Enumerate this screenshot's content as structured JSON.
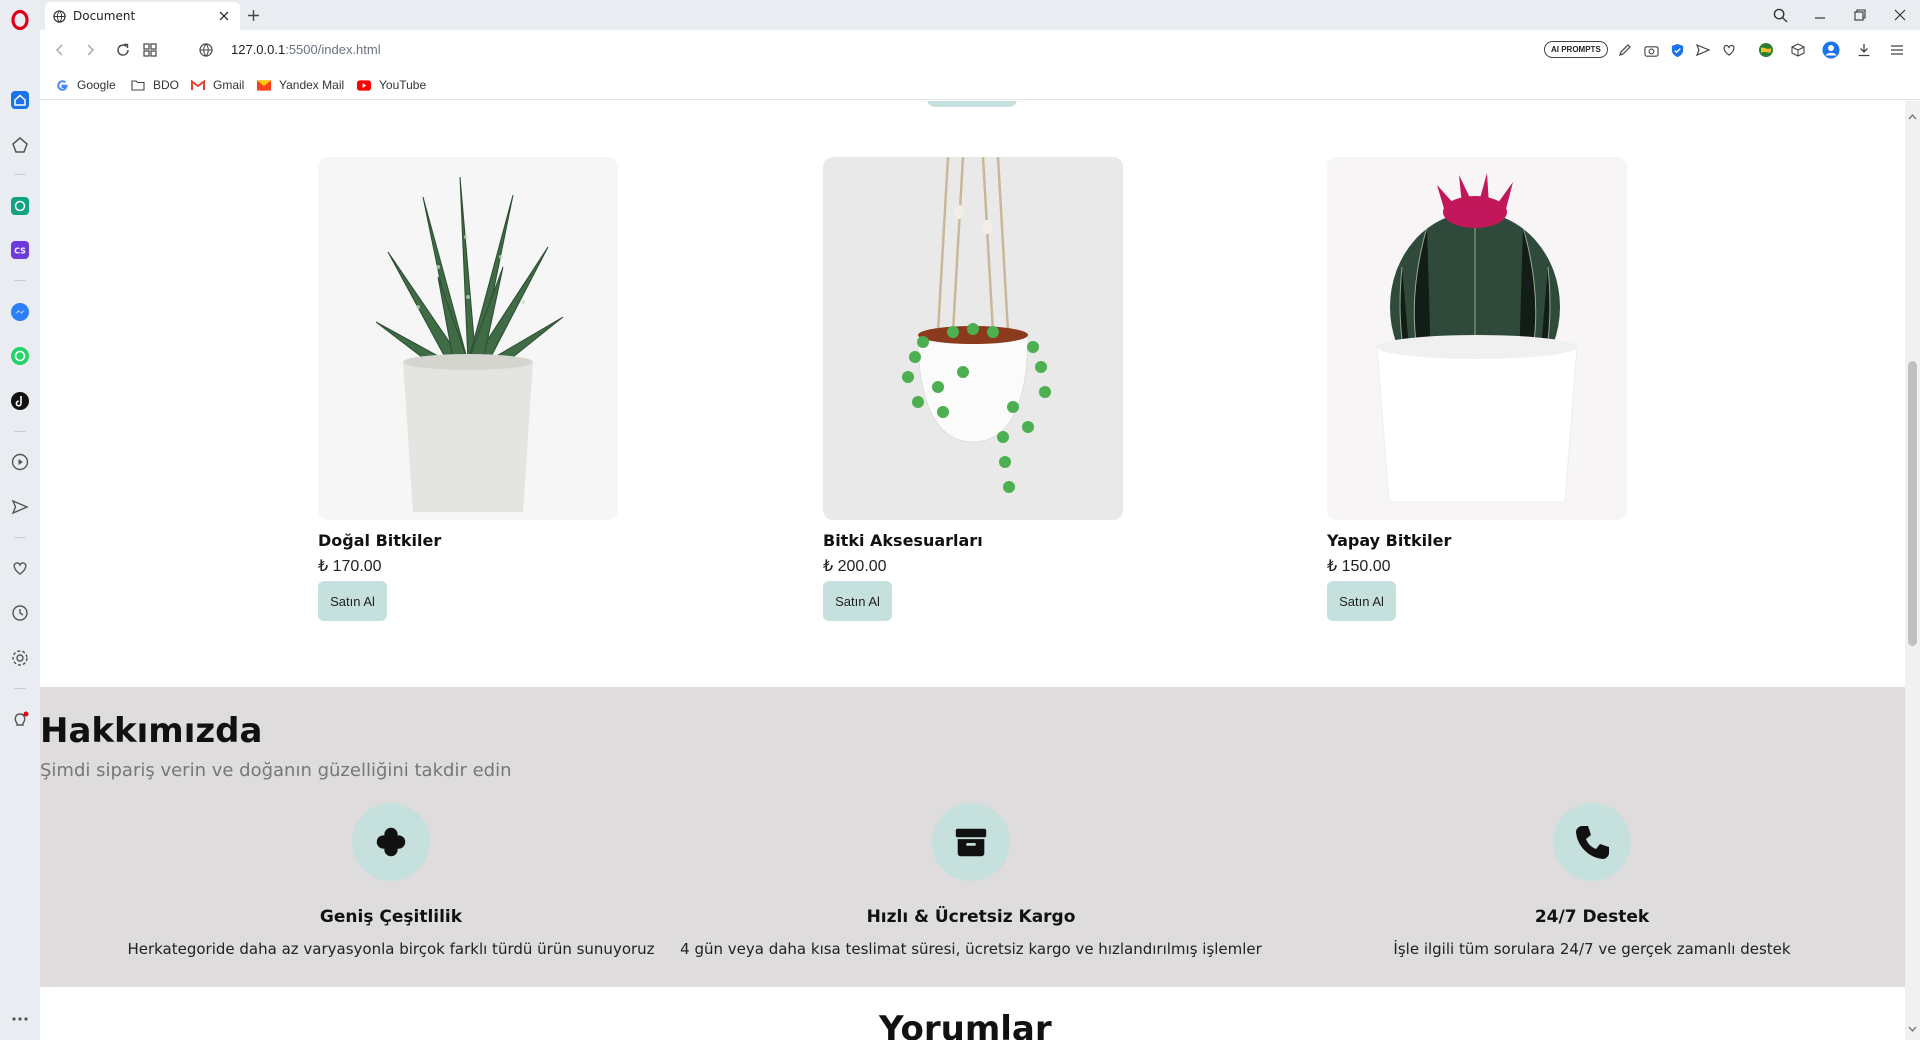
{
  "browser": {
    "tab_title": "Document",
    "url_host": "127.0.0.1",
    "url_rest": ":5500/index.html",
    "ai_prompts_label": "AI PROMPTS",
    "bookmarks": [
      {
        "label": "Google",
        "icon": "google-icon"
      },
      {
        "label": "BDO",
        "icon": "folder-icon"
      },
      {
        "label": "Gmail",
        "icon": "gmail-icon"
      },
      {
        "label": "Yandex Mail",
        "icon": "yandex-mail-icon"
      },
      {
        "label": "YouTube",
        "icon": "youtube-icon"
      }
    ]
  },
  "products": [
    {
      "name": "Doğal Bitkiler",
      "price": "₺ 170.00",
      "button": "Satın Al"
    },
    {
      "name": "Bitki Aksesuarları",
      "price": "₺ 200.00",
      "button": "Satın Al"
    },
    {
      "name": "Yapay Bitkiler",
      "price": "₺ 150.00",
      "button": "Satın Al"
    }
  ],
  "about": {
    "title": "Hakkımızda",
    "subtitle": "Şimdi sipariş verin ve doğanın güzelliğini takdir edin",
    "features": [
      {
        "icon": "clover-icon",
        "title": "Geniş Çeşitlilik",
        "desc": "Herkategoride daha az varyasyonla birçok farklı türdü ürün sunuyoruz"
      },
      {
        "icon": "box-icon",
        "title": "Hızlı & Ücretsiz Kargo",
        "desc": "4 gün veya daha kısa teslimat süresi, ücretsiz kargo ve hızlandırılmış işlemler"
      },
      {
        "icon": "phone-icon",
        "title": "24/7 Destek",
        "desc": "İşle ilgili tüm sorulara 24/7 ve gerçek zamanlı destek"
      }
    ]
  },
  "next_section_heading": "Yorumlar",
  "colors": {
    "accent": "#c5e0dd",
    "about_bg": "#dedcdd",
    "opera_red": "#e0001b"
  }
}
